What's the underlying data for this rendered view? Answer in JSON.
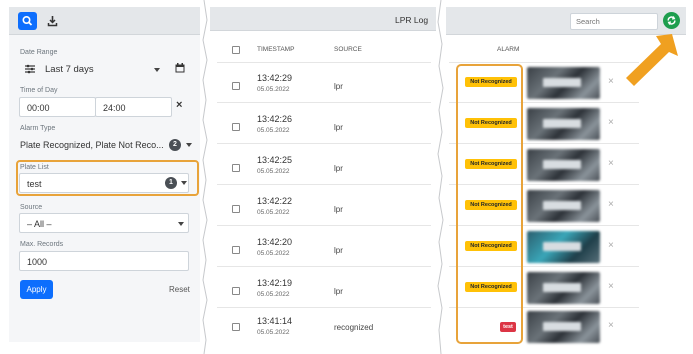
{
  "filters": {
    "date_range": {
      "label": "Date Range",
      "value": "Last 7 days"
    },
    "time_of_day": {
      "label": "Time of Day",
      "from": "00:00",
      "to": "24:00"
    },
    "alarm_type": {
      "label": "Alarm Type",
      "value": "Plate Recognized, Plate Not Reco...",
      "count": "2"
    },
    "plate_list": {
      "label": "Plate List",
      "value": "test",
      "count": "1"
    },
    "source": {
      "label": "Source",
      "value": "– All –"
    },
    "max_records": {
      "label": "Max. Records",
      "value": "1000"
    },
    "apply_label": "Apply",
    "reset_label": "Reset"
  },
  "table": {
    "title": "LPR Log",
    "columns": {
      "timestamp": "TIMESTAMP",
      "source": "SOURCE",
      "alarm": "ALARM"
    },
    "rows": [
      {
        "time": "13:42:29",
        "date": "05.05.2022",
        "source": "lpr",
        "alarm": "Not Recognized"
      },
      {
        "time": "13:42:26",
        "date": "05.05.2022",
        "source": "lpr",
        "alarm": "Not Recognized"
      },
      {
        "time": "13:42:25",
        "date": "05.05.2022",
        "source": "lpr",
        "alarm": "Not Recognized"
      },
      {
        "time": "13:42:22",
        "date": "05.05.2022",
        "source": "lpr",
        "alarm": "Not Recognized"
      },
      {
        "time": "13:42:20",
        "date": "05.05.2022",
        "source": "lpr",
        "alarm": "Not Recognized"
      },
      {
        "time": "13:42:19",
        "date": "05.05.2022",
        "source": "lpr",
        "alarm": "Not Recognized"
      },
      {
        "time": "13:41:14",
        "date": "05.05.2022",
        "source": "recognized",
        "alarm": "test"
      }
    ]
  },
  "search": {
    "placeholder": "Search"
  },
  "icons": {
    "search": "search-icon",
    "export": "download-icon",
    "calendar": "calendar-icon",
    "refresh": "refresh-icon",
    "delete": "close-icon"
  },
  "colors": {
    "primary": "#0d6efd",
    "warning_badge": "#ffc107",
    "danger_badge": "#dc3545",
    "refresh": "#1e9e4e",
    "highlight": "#e8a33a"
  }
}
